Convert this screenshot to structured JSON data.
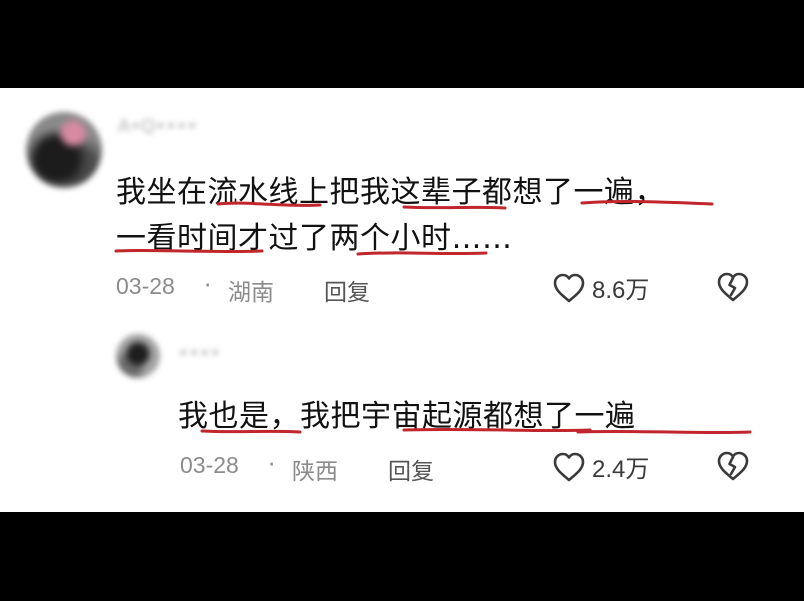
{
  "accent_color": "#c0262b",
  "comment": {
    "username": "A•Q••••",
    "text_line1": "我坐在流水线上把我这辈子都想了一遍，",
    "text_line2": "一看时间才过了两个小时……",
    "date": "03-28",
    "separator": "·",
    "location": "湖南",
    "reply_label": "回复",
    "likes": "8.6万"
  },
  "reply": {
    "username": "••••",
    "text": "我也是，我把宇宙起源都想了一遍",
    "date": "03-28",
    "separator": "·",
    "location": "陕西",
    "reply_label": "回复",
    "likes": "2.4万"
  }
}
